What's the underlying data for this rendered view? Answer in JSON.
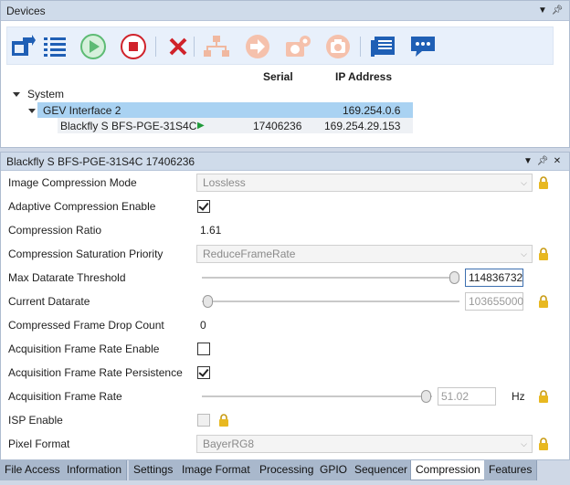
{
  "devices_panel": {
    "title": "Devices",
    "columns": {
      "serial": "Serial",
      "ip": "IP Address"
    },
    "tree": {
      "root": "System",
      "interface": {
        "name": "GEV Interface 2",
        "ip": "169.254.0.6"
      },
      "camera": {
        "name": "Blackfly S BFS-PGE-31S4C",
        "serial": "17406236",
        "ip": "169.254.29.153"
      }
    },
    "toolbar_icons": [
      "refresh-icon",
      "list-icon",
      "play-icon",
      "stop-icon",
      "disconnect-icon",
      "network-icon",
      "forward-icon",
      "camera-settings-icon",
      "snapshot-icon",
      "log-icon",
      "chat-icon"
    ]
  },
  "props_panel": {
    "title": "Blackfly S BFS-PGE-31S4C 17406236",
    "rows": {
      "image_compression_mode": {
        "label": "Image Compression Mode",
        "value": "Lossless"
      },
      "adaptive_compression": {
        "label": "Adaptive Compression Enable"
      },
      "compression_ratio": {
        "label": "Compression Ratio",
        "value": "1.61"
      },
      "saturation_priority": {
        "label": "Compression Saturation Priority",
        "value": "ReduceFrameRate"
      },
      "max_datarate": {
        "label": "Max Datarate Threshold",
        "value": "114836732"
      },
      "current_datarate": {
        "label": "Current Datarate",
        "value": "103655000"
      },
      "frame_drop_count": {
        "label": "Compressed Frame Drop Count",
        "value": "0"
      },
      "afr_enable": {
        "label": "Acquisition Frame Rate Enable"
      },
      "afr_persistence": {
        "label": "Acquisition Frame Rate Persistence"
      },
      "afr": {
        "label": "Acquisition Frame Rate",
        "value": "51.02",
        "unit": "Hz"
      },
      "isp_enable": {
        "label": "ISP Enable"
      },
      "pixel_format": {
        "label": "Pixel Format",
        "value": "BayerRG8"
      }
    }
  },
  "tabs": [
    "File Access",
    "Information",
    "Settings",
    "Image Format",
    "Processing",
    "GPIO",
    "Sequencer",
    "Compression",
    "Features"
  ],
  "active_tab": "Compression"
}
